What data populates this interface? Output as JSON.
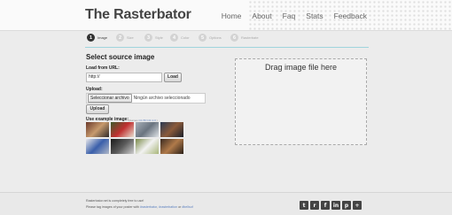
{
  "header": {
    "logo": "The Rasterbator",
    "nav": [
      "Home",
      "About",
      "Faq",
      "Stats",
      "Feedback"
    ]
  },
  "steps": [
    {
      "num": "1",
      "label": "Image",
      "active": true
    },
    {
      "num": "2",
      "label": "Size",
      "active": false
    },
    {
      "num": "3",
      "label": "Style",
      "active": false
    },
    {
      "num": "4",
      "label": "Color",
      "active": false
    },
    {
      "num": "5",
      "label": "Options",
      "active": false
    },
    {
      "num": "6",
      "label": "Rasterbate",
      "active": false
    }
  ],
  "source": {
    "title": "Select source image",
    "load_url_label": "Load from URL:",
    "url_value": "http://",
    "load_button": "Load",
    "upload_label": "Upload:",
    "choose_file_button": "Seleccionar archivo",
    "file_status": "Ningún archivo seleccionado",
    "upload_button": "Upload",
    "examples_label": "Use example image:",
    "credits_prefix": "(Games",
    "credits_links": "CC BY-NC 2.0",
    "credits_suffix": ")"
  },
  "examples": [
    {
      "name": "example-image-1",
      "colors": [
        "#6b3a2b",
        "#c79a6d",
        "#2f2a2a"
      ]
    },
    {
      "name": "example-image-2",
      "colors": [
        "#3d5a2a",
        "#c03030",
        "#e8e0d0"
      ]
    },
    {
      "name": "example-image-3",
      "colors": [
        "#a8b0b8",
        "#6a7480",
        "#dfe3e6"
      ]
    },
    {
      "name": "example-image-4",
      "colors": [
        "#2b3a52",
        "#8a5a3a",
        "#1a1f2a"
      ]
    },
    {
      "name": "example-image-5",
      "colors": [
        "#e8e8ea",
        "#3a5faa",
        "#b0b8c8"
      ]
    },
    {
      "name": "example-image-6",
      "colors": [
        "#1a1a1a",
        "#5a5a5a",
        "#cfcfcf"
      ]
    },
    {
      "name": "example-image-7",
      "colors": [
        "#7a8a4a",
        "#f2f2f2",
        "#a9b77a"
      ]
    },
    {
      "name": "example-image-8",
      "colors": [
        "#3a2a20",
        "#b07a4a",
        "#2a2018"
      ]
    }
  ],
  "drop_zone": {
    "text": "Drag image file here"
  },
  "footer": {
    "line1": "Rasterbator.net is completely free to use!",
    "line2_prefix": "Please tag images of your poster with ",
    "line2_tag1": "#rasterbator",
    "line2_sep1": ", ",
    "line2_tag2": "#rasterbation",
    "line2_sep2": " or ",
    "line2_tag3": "#bellsof",
    "social": [
      {
        "name": "twitter-icon",
        "glyph": "t"
      },
      {
        "name": "reddit-icon",
        "glyph": "r"
      },
      {
        "name": "facebook-icon",
        "glyph": "f"
      },
      {
        "name": "linkedin-icon",
        "glyph": "in"
      },
      {
        "name": "pinterest-icon",
        "glyph": "p"
      },
      {
        "name": "plus-icon",
        "glyph": "+"
      }
    ]
  }
}
